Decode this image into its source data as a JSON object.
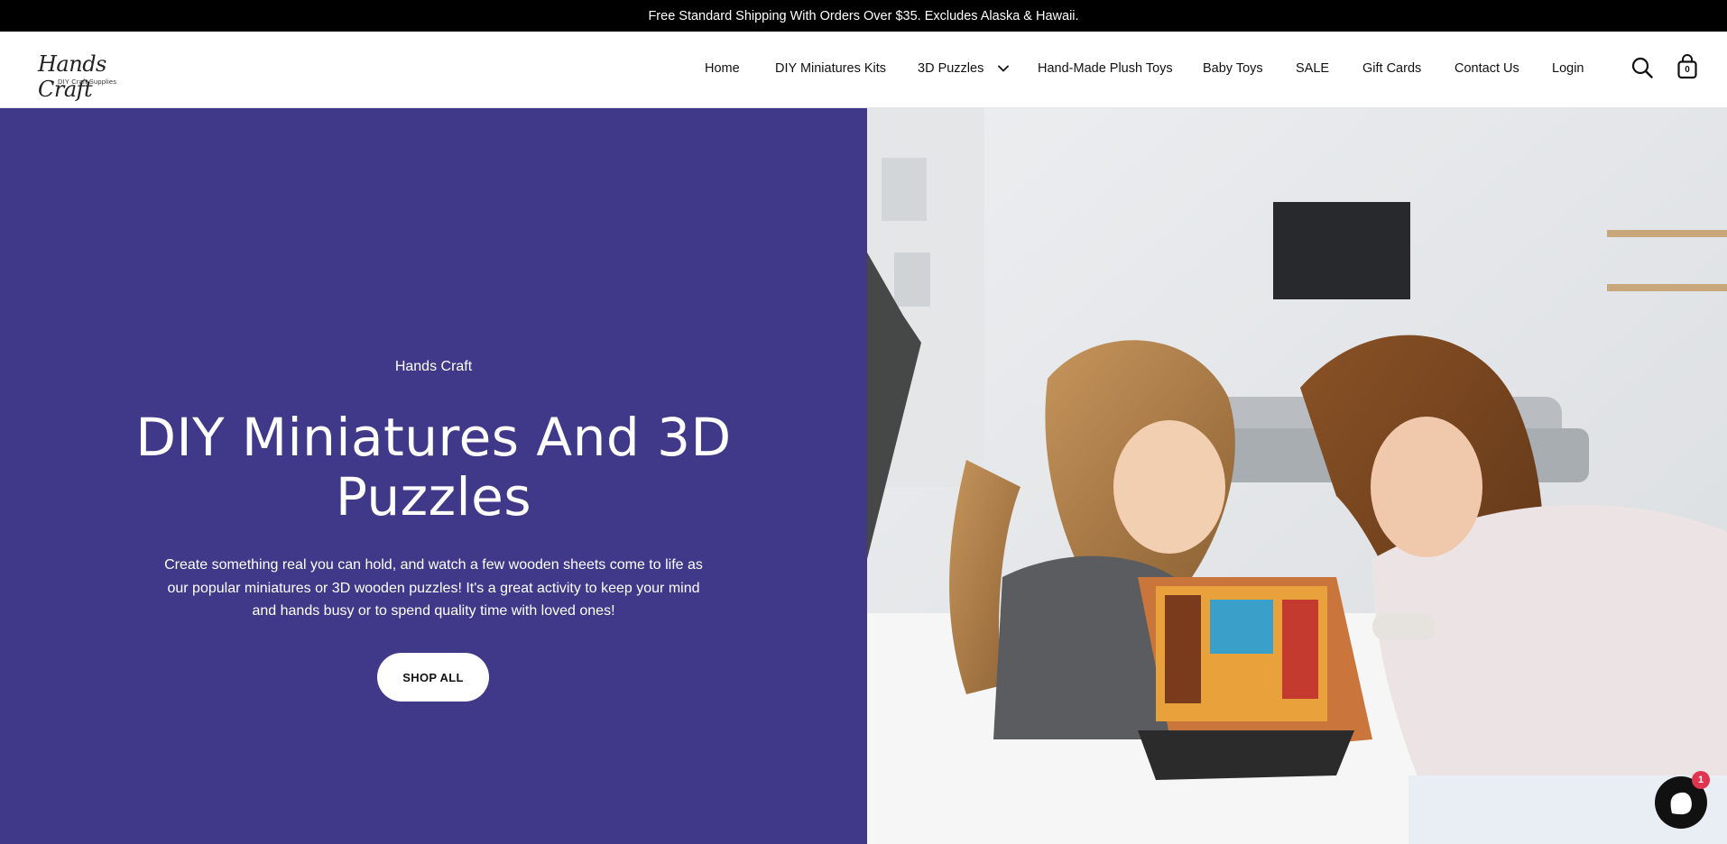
{
  "announcement": {
    "text": "Free Standard Shipping With Orders Over $35. Excludes Alaska & Hawaii."
  },
  "logo": {
    "main": "Hands Craft",
    "sub": "DIY Craft Supplies"
  },
  "nav": {
    "items": [
      {
        "label": "Home"
      },
      {
        "label": "DIY Miniatures Kits"
      },
      {
        "label": "3D Puzzles"
      },
      {
        "label": "Hand-Made Plush Toys"
      },
      {
        "label": "Baby Toys"
      },
      {
        "label": "SALE"
      },
      {
        "label": "Gift Cards"
      },
      {
        "label": "Contact Us"
      },
      {
        "label": "Login"
      }
    ]
  },
  "cart": {
    "count": "0"
  },
  "hero": {
    "eyebrow": "Hands Craft",
    "title": "DIY Miniatures And 3D Puzzles",
    "description": "Create something real you can hold, and watch a few wooden sheets come to life as our popular miniatures or 3D wooden puzzles! It's a great activity to keep your mind and hands busy or to spend quality time with loved ones!",
    "cta": "SHOP ALL",
    "background_color": "#40398a"
  },
  "chat": {
    "badge": "1"
  },
  "icons": {
    "search": "search-icon",
    "cart": "shopping-bag-icon",
    "dropdown": "chevron-down-icon",
    "chat": "chat-bubble-icon"
  }
}
